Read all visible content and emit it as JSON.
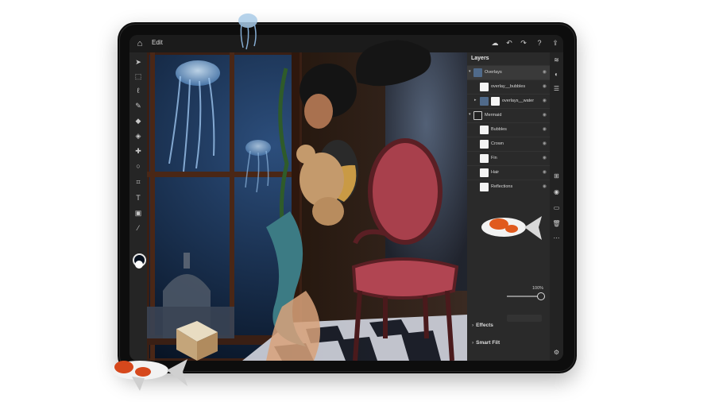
{
  "app": {
    "mode_label": "Edit"
  },
  "topbar": {
    "icons": [
      "home-icon",
      "cloud-icon",
      "undo-icon",
      "redo-icon",
      "help-icon",
      "share-icon"
    ]
  },
  "toolbar": {
    "tools": [
      "move-tool-icon",
      "select-tool-icon",
      "lasso-tool-icon",
      "brush-tool-icon",
      "eraser-tool-icon",
      "fill-tool-icon",
      "healing-tool-icon",
      "clone-tool-icon",
      "crop-tool-icon",
      "type-tool-icon",
      "place-image-icon",
      "eyedropper-icon"
    ],
    "foreground_color": "#06101e",
    "background_color": "#ffffff"
  },
  "layers_panel": {
    "title": "Layers",
    "layers": [
      {
        "name": "Overlays",
        "thumb": "dark",
        "indent": 0,
        "caret": "▾",
        "selected": true
      },
      {
        "name": "overlay__bubbles",
        "thumb": "light",
        "indent": 1,
        "caret": "",
        "selected": false
      },
      {
        "name": "overlays__water",
        "thumb": "light",
        "indent": 1,
        "caret": "▸",
        "selected": false
      },
      {
        "name": "Mermaid",
        "thumb": "mer",
        "indent": 0,
        "caret": "▾",
        "selected": false
      },
      {
        "name": "Bubbles",
        "thumb": "light",
        "indent": 1,
        "caret": "",
        "selected": false
      },
      {
        "name": "Crown",
        "thumb": "light",
        "indent": 1,
        "caret": "",
        "selected": false
      },
      {
        "name": "Fin",
        "thumb": "light",
        "indent": 1,
        "caret": "",
        "selected": false
      },
      {
        "name": "Hair",
        "thumb": "light",
        "indent": 1,
        "caret": "",
        "selected": false
      },
      {
        "name": "Reflections",
        "thumb": "light",
        "indent": 1,
        "caret": "",
        "selected": false
      }
    ],
    "opacity_value": "100%",
    "sections": [
      "Effects",
      "Smart Filt"
    ]
  },
  "right_rail": {
    "icons": [
      "layers-icon",
      "adjust-icon",
      "properties-icon",
      "add-layer-icon",
      "visibility-icon",
      "group-icon",
      "delete-icon",
      "more-icon",
      "settings-icon"
    ]
  },
  "colors": {
    "app_background": "#1e1e1e",
    "panel": "#2a2a2a",
    "chair_red": "#a8404c"
  }
}
